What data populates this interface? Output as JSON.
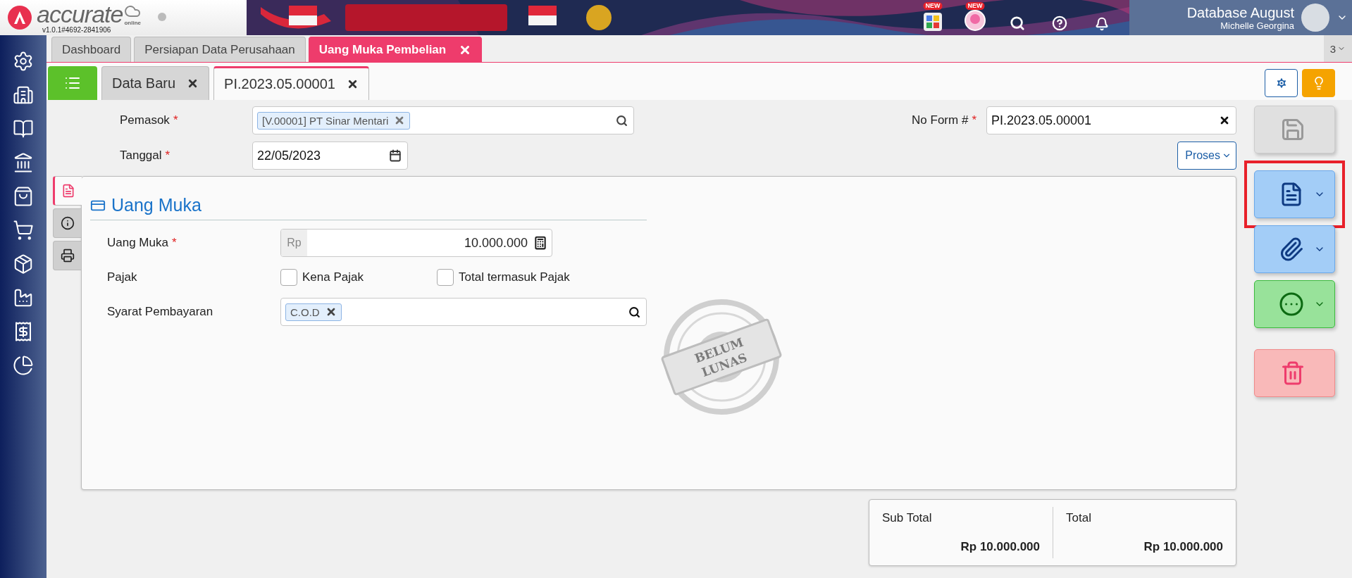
{
  "header": {
    "logo_text": "accurate",
    "logo_sub": "online",
    "version": "v1.0.1#4692-2841906",
    "badges": [
      "NEW",
      "NEW"
    ],
    "database": "Database August",
    "user": "Michelle Georgina"
  },
  "module_tabs": [
    {
      "label": "Dashboard",
      "selected": false,
      "closable": false
    },
    {
      "label": "Persiapan Data Perusahaan",
      "selected": false,
      "closable": false
    },
    {
      "label": "Uang Muka Pembelian",
      "selected": true,
      "closable": true
    }
  ],
  "tab_count": "3",
  "doc_tabs": [
    {
      "label": "Data Baru",
      "selected": false
    },
    {
      "label": "PI.2023.05.00001",
      "selected": true
    }
  ],
  "form": {
    "supplier": {
      "label": "Pemasok",
      "required_mark": "*",
      "tag": "[V.00001] PT Sinar Mentari"
    },
    "date": {
      "label": "Tanggal",
      "required_mark": "*",
      "value": "22/05/2023"
    },
    "form_no": {
      "label": "No Form #",
      "required_mark": "*",
      "value": "PI.2023.05.00001"
    },
    "process_button": "Proses"
  },
  "side_tabs": [
    {
      "kind": "detail",
      "selected": true
    },
    {
      "kind": "info",
      "selected": false
    },
    {
      "kind": "print",
      "selected": false
    }
  ],
  "section": {
    "title": "Uang Muka",
    "amount": {
      "label": "Uang Muka",
      "required_mark": "*",
      "currency": "Rp",
      "value": "10.000.000"
    },
    "tax": {
      "label": "Pajak",
      "options": [
        {
          "label": "Kena Pajak",
          "checked": false
        },
        {
          "label": "Total termasuk Pajak",
          "checked": false
        }
      ]
    },
    "terms": {
      "label": "Syarat Pembayaran",
      "tag": "C.O.D"
    }
  },
  "stamp": [
    "BELUM",
    "LUNAS"
  ],
  "totals": [
    {
      "label": "Sub Total",
      "value": "Rp 10.000.000"
    },
    {
      "label": "Total",
      "value": "Rp 10.000.000"
    }
  ],
  "actions": [
    {
      "kind": "save",
      "disabled": true,
      "highlighted": false
    },
    {
      "kind": "print",
      "disabled": false,
      "highlighted": true
    },
    {
      "kind": "attach",
      "disabled": false,
      "highlighted": false
    },
    {
      "kind": "more",
      "disabled": false,
      "highlighted": false
    },
    {
      "kind": "delete",
      "disabled": false,
      "highlighted": false
    }
  ]
}
